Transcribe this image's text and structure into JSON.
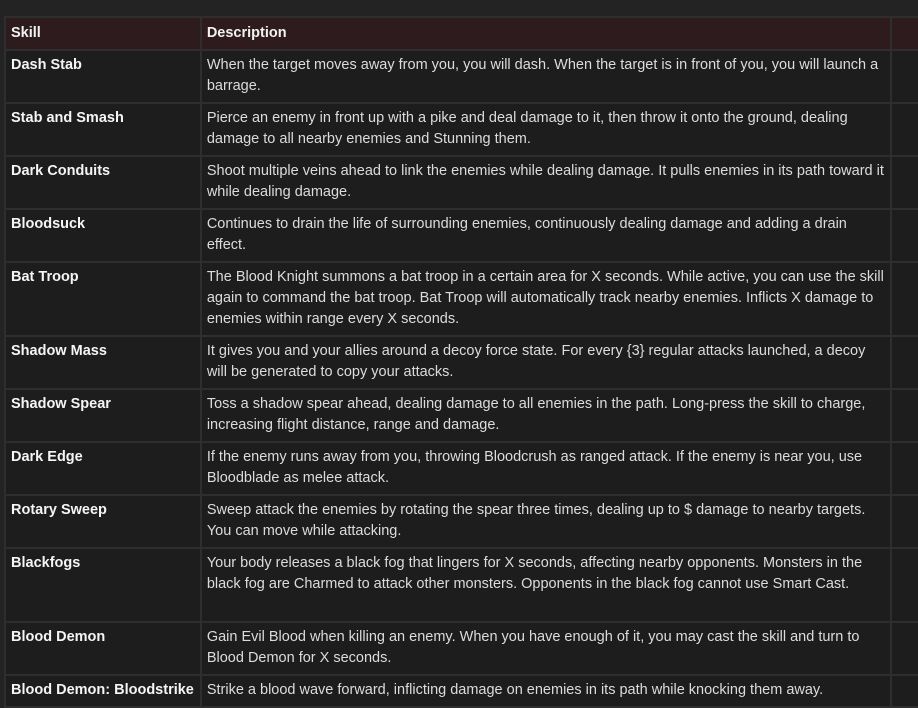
{
  "table": {
    "headers": [
      "Skill",
      "Description",
      ""
    ],
    "rows": [
      {
        "skill": "Dash Stab",
        "description": "When the target moves away from you, you will dash. When the target is in front of you, you will launch a barrage."
      },
      {
        "skill": "Stab and Smash",
        "description": "Pierce an enemy in front up with a pike and deal damage to it, then throw it onto the ground, dealing damage to all nearby enemies and Stunning them."
      },
      {
        "skill": "Dark Conduits",
        "description": "Shoot multiple veins ahead to link the enemies while dealing damage. It pulls enemies in its path toward it while dealing damage."
      },
      {
        "skill": "Bloodsuck",
        "description": "Continues to drain the life of surrounding enemies, continuously dealing damage and adding a drain effect."
      },
      {
        "skill": "Bat Troop",
        "description": "The Blood Knight summons a bat troop in a certain area for X seconds. While active, you can use the skill again to command the bat troop. Bat Troop will automatically track nearby enemies. Inflicts X damage to enemies within range every X seconds."
      },
      {
        "skill": "Shadow Mass",
        "description": "It gives you and your allies around a decoy force state. For every {3} regular attacks launched, a decoy will be generated to copy your attacks."
      },
      {
        "skill": "Shadow Spear",
        "description": "Toss a shadow spear ahead, dealing damage to all enemies in the path. Long-press the skill to charge, increasing flight distance, range and damage."
      },
      {
        "skill": "Dark Edge",
        "description": "If the enemy runs away from you, throwing Bloodcrush as ranged attack. If the enemy is near you, use Bloodblade as melee attack."
      },
      {
        "skill": "Rotary Sweep",
        "description": "Sweep attack the enemies by rotating the spear three times, dealing up to $ damage to nearby targets. You can move while attacking."
      },
      {
        "skill": "Blackfogs",
        "description": "Your body releases a black fog that lingers for X seconds, affecting nearby opponents. Monsters in the black fog are Charmed to attack other monsters. Opponents in the black fog cannot use Smart Cast."
      },
      {
        "skill": "Blood Demon",
        "description": "Gain Evil Blood when killing an enemy. When you have enough of it, you may cast the skill and turn to Blood Demon for X seconds."
      },
      {
        "skill": "Blood Demon: Bloodstrike",
        "description": "Strike a blood wave forward, inflicting damage on enemies in its path while knocking them away."
      }
    ]
  },
  "colors": {
    "page_background": "#232323",
    "header_background": "#2d1b1e",
    "cell_background": "#1d1d1d",
    "border": "#2e2e2e",
    "text": "#e6e6e6"
  }
}
